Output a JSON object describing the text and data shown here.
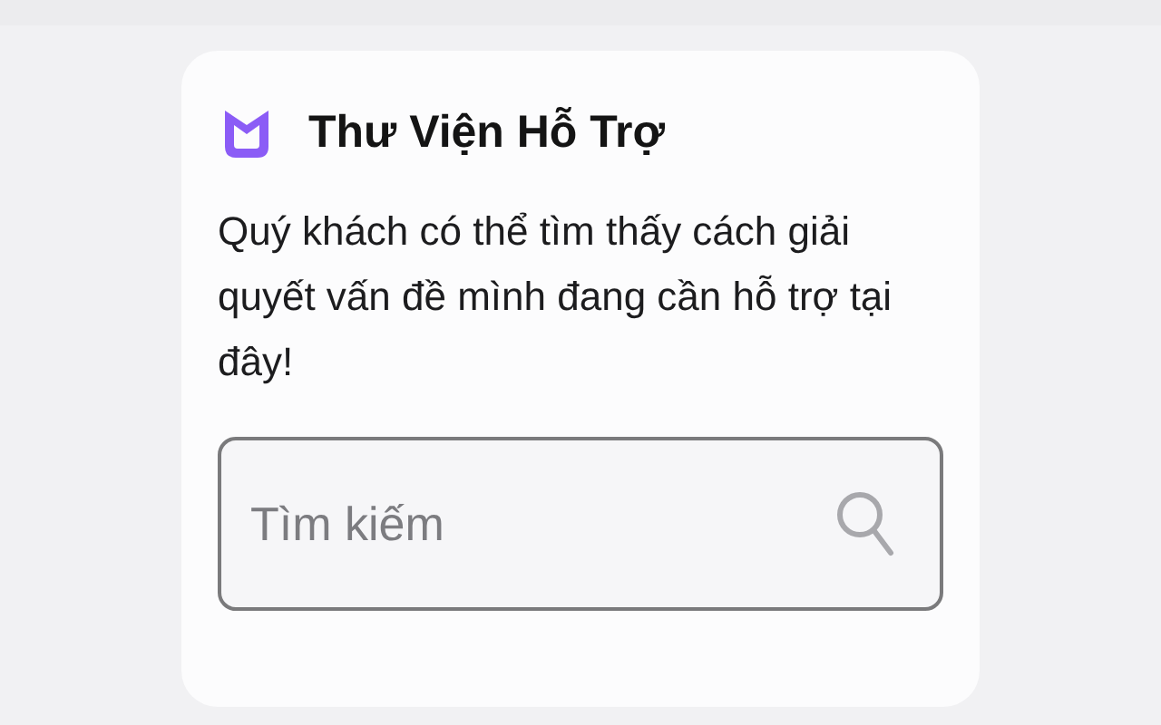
{
  "card": {
    "title": "Thư Viện Hỗ Trợ",
    "description": "Quý khách có thể tìm thấy cách giải quyết vấn đề mình đang cần hỗ trợ tại đây!",
    "search": {
      "placeholder": "Tìm kiếm"
    }
  }
}
